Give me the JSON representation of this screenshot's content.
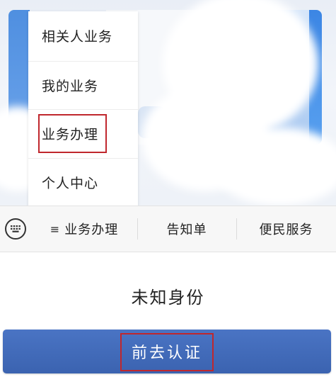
{
  "dropdown_menu": {
    "items": [
      {
        "label": "相关人业务"
      },
      {
        "label": "我的业务"
      },
      {
        "label": "业务办理"
      },
      {
        "label": "个人中心"
      }
    ],
    "highlighted_item": "业务办理"
  },
  "tabbar": {
    "keyboard_icon": "keyboard-icon",
    "tabs": [
      {
        "label": "业务办理",
        "icon": "menu-lines-icon",
        "glyph": "≡"
      },
      {
        "label": "告知单"
      },
      {
        "label": "便民服务"
      }
    ]
  },
  "status": {
    "text": "未知身份"
  },
  "action": {
    "button_label": "前去认证",
    "color": "#3f69b8"
  },
  "colors": {
    "highlight_border": "#c0272d",
    "accent_blue": "#3f69b8"
  }
}
